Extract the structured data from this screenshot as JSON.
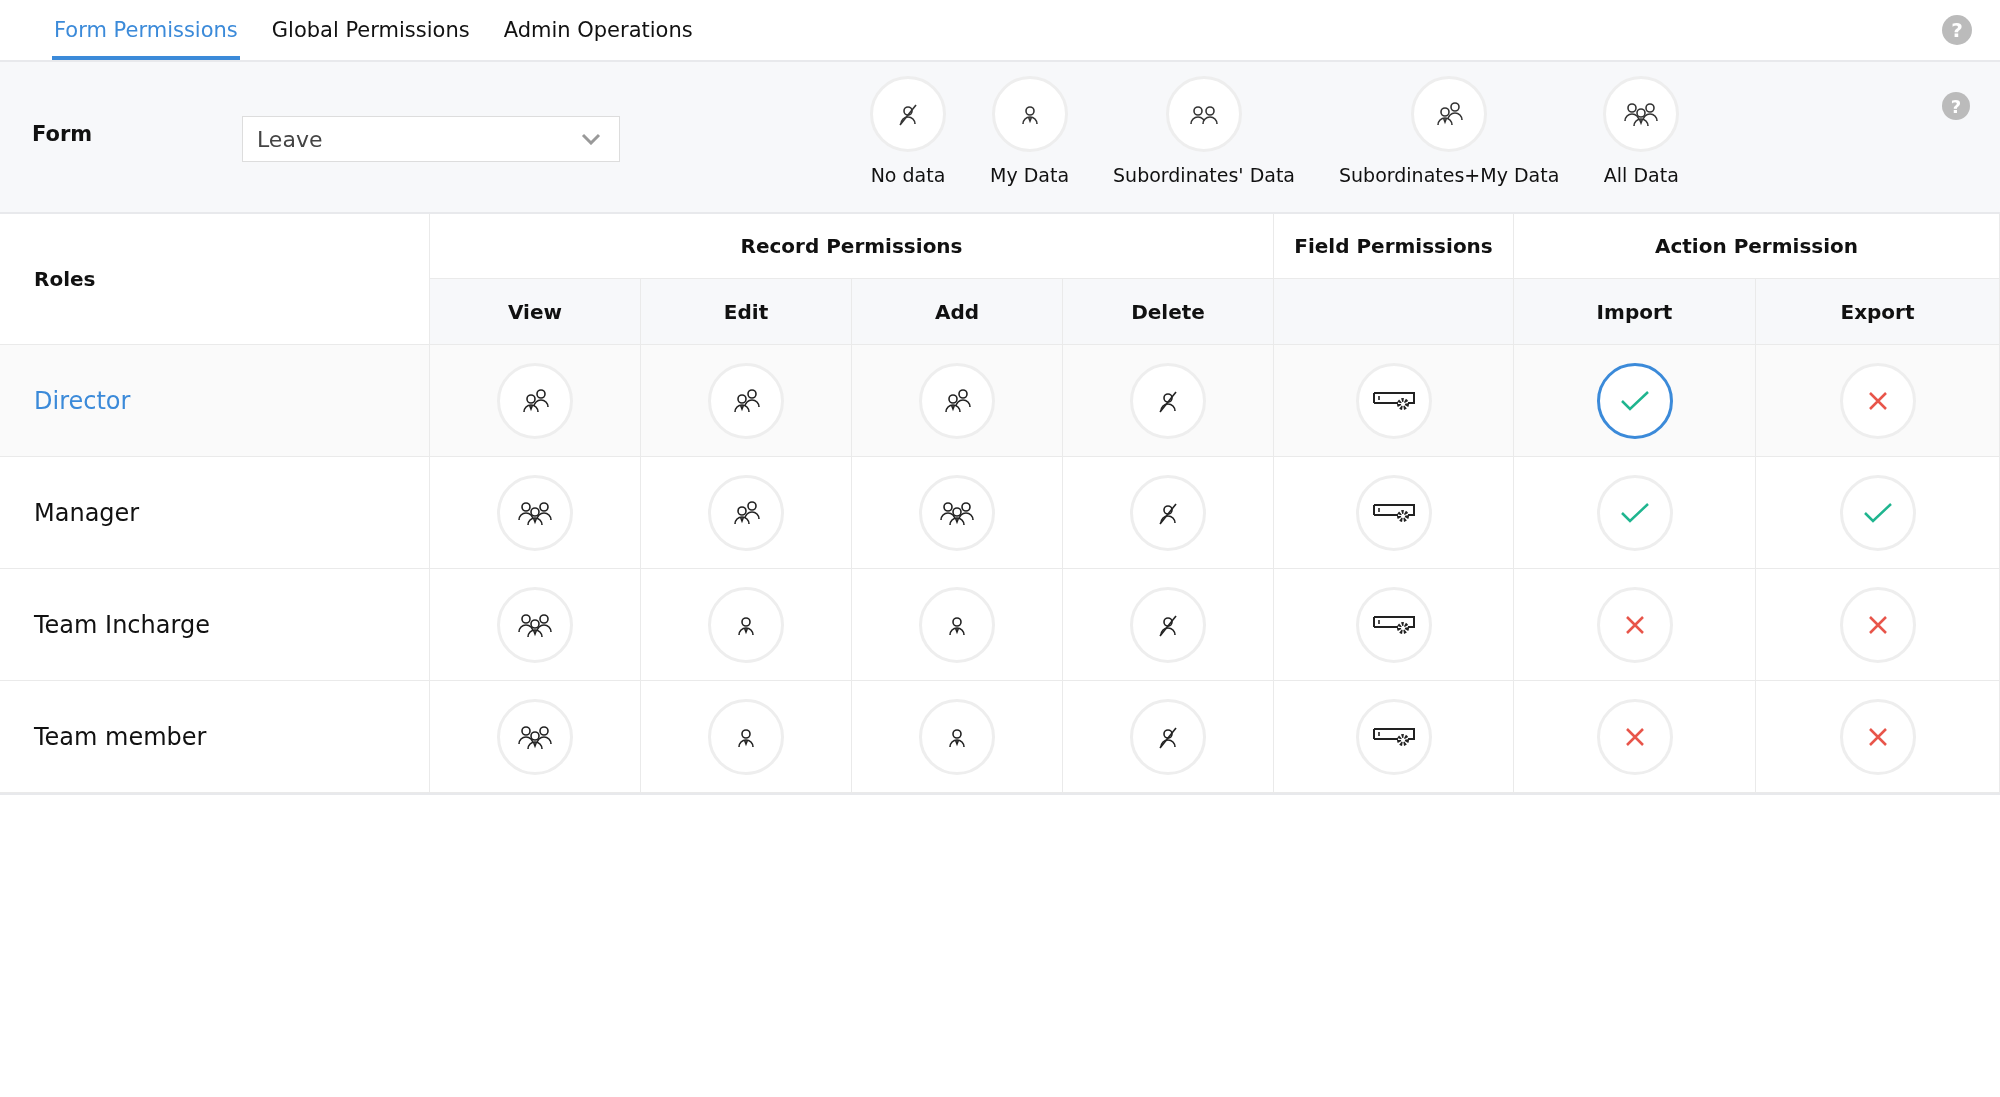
{
  "tabs": [
    {
      "label": "Form Permissions",
      "selected": true
    },
    {
      "label": "Global Permissions",
      "selected": false
    },
    {
      "label": "Admin Operations",
      "selected": false
    }
  ],
  "help": "?",
  "form": {
    "label": "Form",
    "value": "Leave"
  },
  "legend": [
    {
      "kind": "none",
      "label": "No data"
    },
    {
      "kind": "my",
      "label": "My Data"
    },
    {
      "kind": "subordinates",
      "label": "Subordinates' Data"
    },
    {
      "kind": "sub_my",
      "label": "Subordinates+My Data"
    },
    {
      "kind": "all",
      "label": "All Data"
    }
  ],
  "panel_help": "?",
  "table": {
    "roles_heading": "Roles",
    "record_heading": "Record Permissions",
    "field_heading": "Field Permissions",
    "action_heading": "Action Permission",
    "record_columns": [
      "View",
      "Edit",
      "Add",
      "Delete"
    ],
    "action_columns": [
      "Import",
      "Export"
    ],
    "rows": [
      {
        "role": "Director",
        "selected": true,
        "record": [
          {
            "kind": "sub_my"
          },
          {
            "kind": "sub_my"
          },
          {
            "kind": "sub_my"
          },
          {
            "kind": "none"
          }
        ],
        "actions": [
          {
            "allowed": true,
            "focused": true
          },
          {
            "allowed": false,
            "focused": false
          }
        ]
      },
      {
        "role": "Manager",
        "selected": false,
        "record": [
          {
            "kind": "all"
          },
          {
            "kind": "sub_my"
          },
          {
            "kind": "all"
          },
          {
            "kind": "none"
          }
        ],
        "actions": [
          {
            "allowed": true,
            "focused": false
          },
          {
            "allowed": true,
            "focused": false
          }
        ]
      },
      {
        "role": "Team Incharge",
        "selected": false,
        "record": [
          {
            "kind": "all"
          },
          {
            "kind": "my"
          },
          {
            "kind": "my"
          },
          {
            "kind": "none"
          }
        ],
        "actions": [
          {
            "allowed": false,
            "focused": false
          },
          {
            "allowed": false,
            "focused": false
          }
        ]
      },
      {
        "role": "Team member",
        "selected": false,
        "record": [
          {
            "kind": "all"
          },
          {
            "kind": "my"
          },
          {
            "kind": "my"
          },
          {
            "kind": "none"
          }
        ],
        "actions": [
          {
            "allowed": false,
            "focused": false
          },
          {
            "allowed": false,
            "focused": false
          }
        ]
      }
    ]
  }
}
